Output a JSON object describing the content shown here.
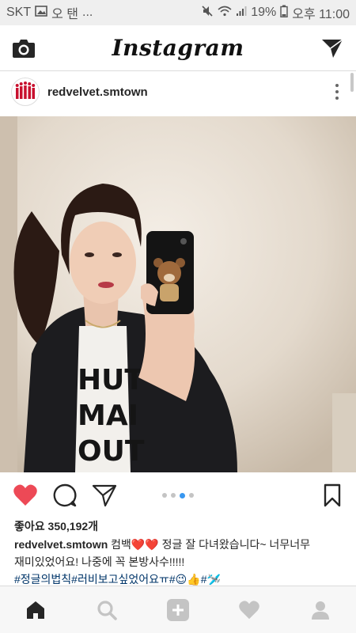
{
  "status_bar": {
    "carrier": "SKT",
    "notif_text": "오 탠",
    "ellipsis": "...",
    "battery": "19%",
    "time": "오후 11:00"
  },
  "header": {
    "logo": "Instagram",
    "left_icon": "camera-icon",
    "right_icon": "direct-message-icon"
  },
  "post": {
    "username": "redvelvet.smtown",
    "likes": "좋아요 350,192개",
    "caption_user": "redvelvet.smtown",
    "caption_line1": "컴백❤️❤️ 정글 잘 다녀왔습니다~ 너무너무",
    "caption_line2": "재미있었어요! 나중에 꼭 본방사수!!!!!",
    "hashtags": "#정글의법칙#러비보고싶었어요ㅠ#😉👍#🛩️",
    "carousel_total": 4,
    "carousel_active": 2
  },
  "colors": {
    "like_red": "#ed4956",
    "hashtag_blue": "#003569",
    "carousel_active": "#3897f0"
  },
  "nav": {
    "items": [
      "home-icon",
      "search-icon",
      "add-post-icon",
      "activity-heart-icon",
      "profile-icon"
    ]
  }
}
